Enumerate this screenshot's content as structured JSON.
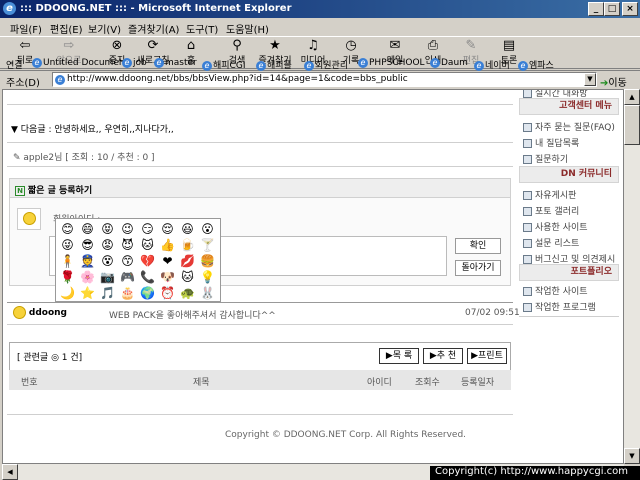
{
  "window": {
    "title": "::: DDOONG.NET ::: - Microsoft Internet Explorer"
  },
  "menu": [
    "파일(F)",
    "편집(E)",
    "보기(V)",
    "즐겨찾기(A)",
    "도구(T)",
    "도움말(H)"
  ],
  "toolbar": [
    {
      "label": "뒤로",
      "icon": "back-arrow-icon",
      "disabled": false
    },
    {
      "label": "앞으로",
      "icon": "forward-arrow-icon",
      "disabled": true
    },
    {
      "label": "중지",
      "icon": "stop-icon",
      "disabled": false
    },
    {
      "label": "새로고침",
      "icon": "refresh-icon",
      "disabled": false
    },
    {
      "label": "홈",
      "icon": "home-icon",
      "disabled": false
    },
    {
      "label": "검색",
      "icon": "search-icon",
      "disabled": false
    },
    {
      "label": "즐겨찾기",
      "icon": "favorites-icon",
      "disabled": false
    },
    {
      "label": "미디어",
      "icon": "media-icon",
      "disabled": false
    },
    {
      "label": "기록",
      "icon": "history-icon",
      "disabled": false
    },
    {
      "label": "메일",
      "icon": "mail-icon",
      "disabled": false
    },
    {
      "label": "인쇄",
      "icon": "print-icon",
      "disabled": false
    },
    {
      "label": "편집",
      "icon": "edit-icon",
      "disabled": true
    },
    {
      "label": "토론",
      "icon": "discuss-icon",
      "disabled": false
    }
  ],
  "links": {
    "label": "연결",
    "items": [
      "Untitled Document",
      "job",
      "master",
      "해피CGI",
      "해피플",
      "회원관리",
      "PHPSCHOOL",
      "Daum",
      "네이버",
      "엠파스"
    ]
  },
  "address": {
    "label": "주소(D)",
    "url": "http://www.ddoong.net/bbs/bbsView.php?id=14&page=1&code=bbs_public",
    "go": "이동"
  },
  "post": {
    "next_label": "▼ 다음글 : 안녕하세요,, 우연히,,지나다가,,",
    "author_info": "apple2님 [ 조회 : 10 / 추천 : 0 ]"
  },
  "comment_form": {
    "title": "짧은 글 등록하기",
    "nickname_label": "회원아이디 :",
    "confirm_button": "확인",
    "back_button": "돌아가기"
  },
  "emoticons": [
    "😊",
    "😄",
    "😝",
    "😉",
    "😏",
    "😌",
    "😃",
    "😮",
    "😜",
    "😎",
    "😡",
    "😈",
    "🐱",
    "👍",
    "🍺",
    "🍸",
    "🧍",
    "👮",
    "😵",
    "😙",
    "💔",
    "❤",
    "💋",
    "🍔",
    "🌹",
    "🌸",
    "📷",
    "🎮",
    "📞",
    "🐶",
    "🐱",
    "💡",
    "🌙",
    "⭐",
    "🎵",
    "🎂",
    "🌍",
    "⏰",
    "🐢",
    "🐰"
  ],
  "comment": {
    "author": "ddoong",
    "text": "WEB PACK을 좋아해주셔서 감사합니다^^",
    "date": "07/02 09:51"
  },
  "related": {
    "label": "[ 관련글 ◎ 1 건]",
    "buttons": [
      "▶목 록",
      "▶추 천",
      "▶프린트"
    ],
    "columns": [
      "번호",
      "제목",
      "아이디",
      "조회수",
      "등록일자"
    ]
  },
  "copyright": "Copyright © DDOONG.NET Corp. All Rights Reserved.",
  "sidebar": {
    "top_link": "실시간 대화방",
    "sections": [
      {
        "title": "고객센터 메뉴",
        "items": [
          "자주 묻는 질문(FAQ)",
          "내 질답목록",
          "질문하기"
        ]
      },
      {
        "title": "DN 커뮤니티",
        "items": [
          "자유게시판",
          "포토 갤러리",
          "사용한 사이트",
          "설문 리스트",
          "버그신고 및 의견제시"
        ]
      },
      {
        "title": "포트폴리오",
        "items": [
          "작업한 사이트",
          "작업한 프로그램"
        ]
      }
    ]
  },
  "status_bar": "Copyright(c) http://www.happycgi.com"
}
